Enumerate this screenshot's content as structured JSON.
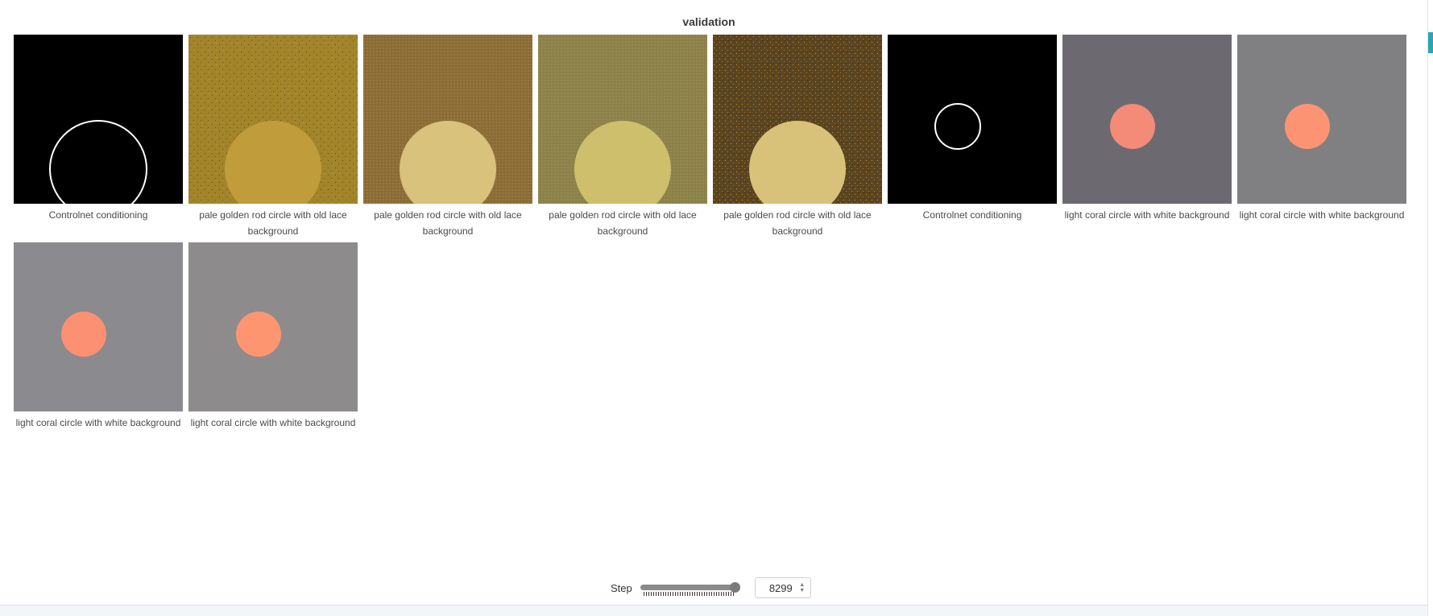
{
  "panel": {
    "title": "validation"
  },
  "images": [
    {
      "caption": "Controlnet conditioning",
      "icon": "controlnet-large-circle-image"
    },
    {
      "caption": "pale golden rod circle with old lace background",
      "icon": "generated-golden-circle-image"
    },
    {
      "caption": "pale golden rod circle with old lace background",
      "icon": "generated-golden-circle-image"
    },
    {
      "caption": "pale golden rod circle with old lace background",
      "icon": "generated-golden-circle-image"
    },
    {
      "caption": "pale golden rod circle with old lace background",
      "icon": "generated-golden-circle-image"
    },
    {
      "caption": "Controlnet conditioning",
      "icon": "controlnet-small-circle-image"
    },
    {
      "caption": "light coral circle with white background",
      "icon": "generated-coral-circle-image"
    },
    {
      "caption": "light coral circle with white background",
      "icon": "generated-coral-circle-image"
    },
    {
      "caption": "light coral circle with white background",
      "icon": "generated-coral-circle-image"
    },
    {
      "caption": "light coral circle with white background",
      "icon": "generated-coral-circle-image"
    }
  ],
  "step": {
    "label": "Step",
    "value": "8299",
    "slider_fraction": 1.0
  },
  "colors": {
    "accent": "#23a8b5",
    "background": "#ffffff"
  }
}
